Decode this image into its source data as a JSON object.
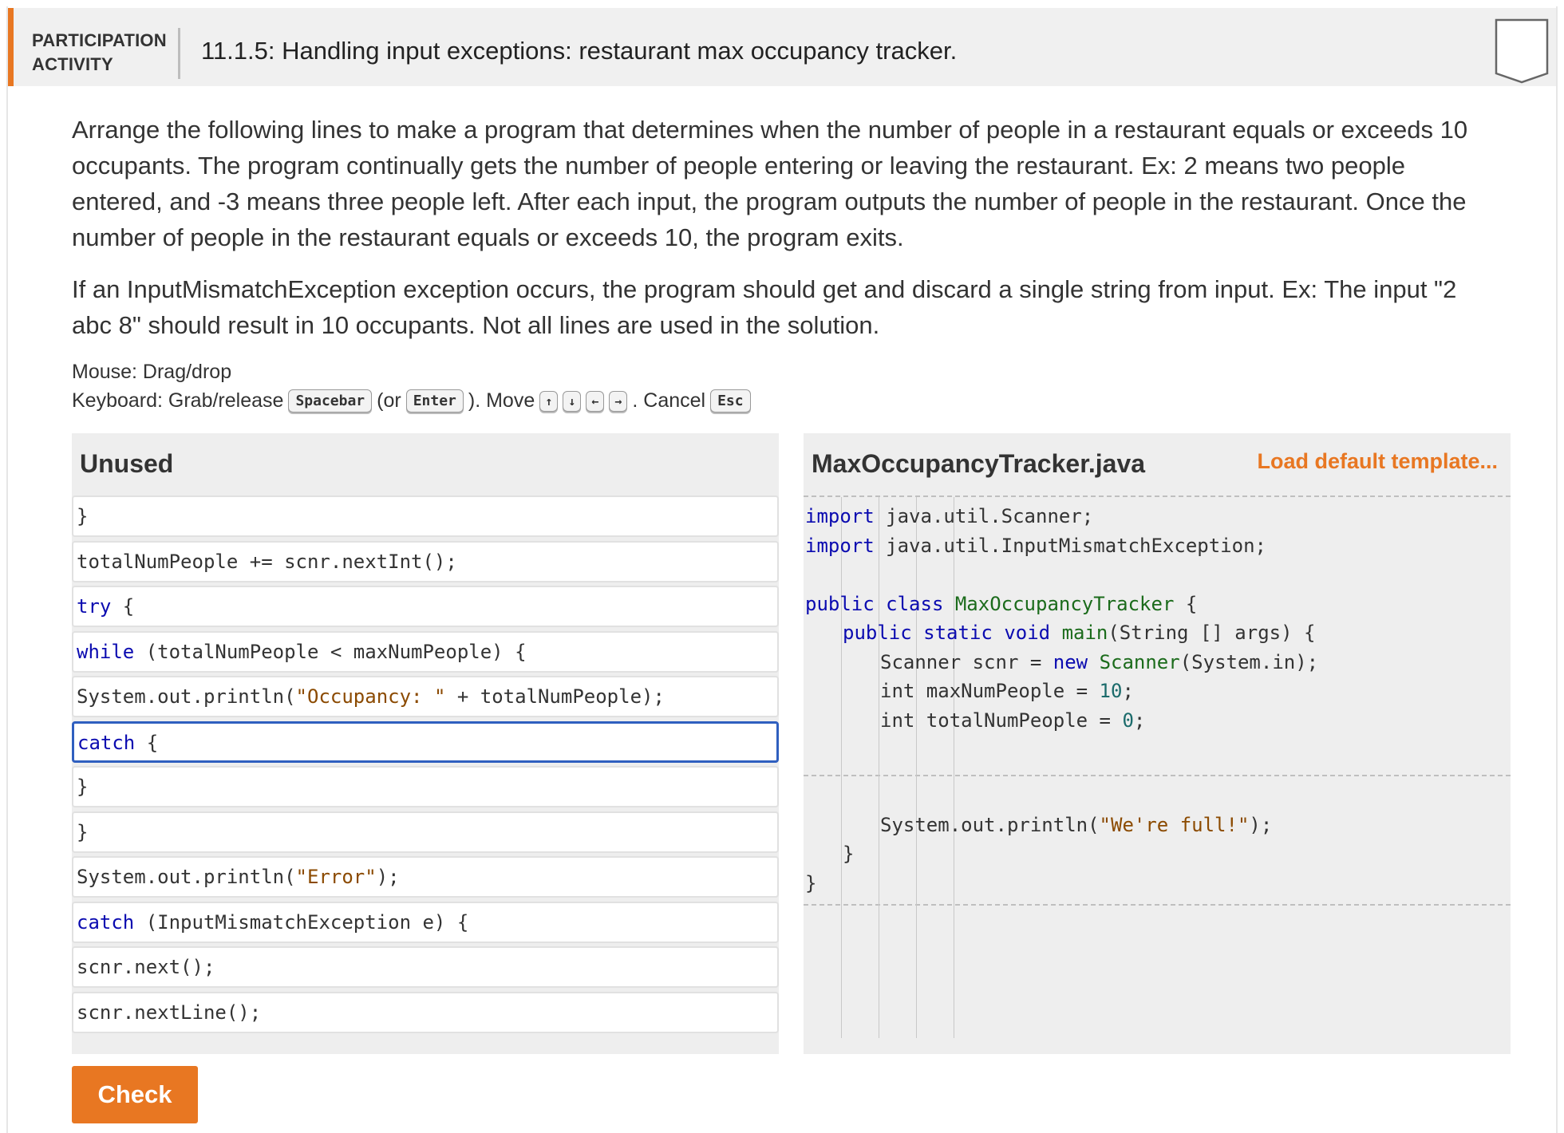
{
  "header": {
    "label_line1": "PARTICIPATION",
    "label_line2": "ACTIVITY",
    "title": "11.1.5: Handling input exceptions: restaurant max occupancy tracker."
  },
  "instructions": {
    "p1": "Arrange the following lines to make a program that determines when the number of people in a restaurant equals or exceeds 10 occupants. The program continually gets the number of people entering or leaving the restaurant. Ex: 2 means two people entered, and -3 means three people left. After each input, the program outputs the number of people in the restaurant. Once the number of people in the restaurant equals or exceeds 10, the program exits.",
    "p2": "If an InputMismatchException exception occurs, the program should get and discard a single string from input. Ex: The input \"2 abc 8\" should result in 10 occupants. Not all lines are used in the solution.",
    "mouse_hint": "Mouse: Drag/drop",
    "kb_prefix": "Keyboard: Grab/release",
    "kb_spacebar": "Spacebar",
    "kb_or": "(or",
    "kb_enter": "Enter",
    "kb_move": "). Move",
    "kb_up": "↑",
    "kb_down": "↓",
    "kb_left": "←",
    "kb_right": "→",
    "kb_cancel": ". Cancel",
    "kb_esc": "Esc"
  },
  "unused": {
    "title": "Unused",
    "blocks": [
      {
        "tokens": [
          {
            "t": "}",
            "c": ""
          }
        ]
      },
      {
        "tokens": [
          {
            "t": "totalNumPeople += scnr.nextInt();",
            "c": ""
          }
        ]
      },
      {
        "tokens": [
          {
            "t": "try",
            "c": "kw"
          },
          {
            "t": " {",
            "c": ""
          }
        ]
      },
      {
        "tokens": [
          {
            "t": "while",
            "c": "kw"
          },
          {
            "t": " (totalNumPeople < maxNumPeople) {",
            "c": ""
          }
        ]
      },
      {
        "tokens": [
          {
            "t": "System.out.println(",
            "c": ""
          },
          {
            "t": "\"Occupancy: \"",
            "c": "str"
          },
          {
            "t": " + totalNumPeople);",
            "c": ""
          }
        ]
      },
      {
        "tokens": [
          {
            "t": "catch",
            "c": "kw"
          },
          {
            "t": " {",
            "c": ""
          }
        ],
        "selected": true
      },
      {
        "tokens": [
          {
            "t": "}",
            "c": ""
          }
        ]
      },
      {
        "tokens": [
          {
            "t": "}",
            "c": ""
          }
        ]
      },
      {
        "tokens": [
          {
            "t": "System.out.println(",
            "c": ""
          },
          {
            "t": "\"Error\"",
            "c": "str"
          },
          {
            "t": ");",
            "c": ""
          }
        ]
      },
      {
        "tokens": [
          {
            "t": "catch",
            "c": "kw"
          },
          {
            "t": " (InputMismatchException e) {",
            "c": ""
          }
        ]
      },
      {
        "tokens": [
          {
            "t": "scnr.next();",
            "c": ""
          }
        ]
      },
      {
        "tokens": [
          {
            "t": "scnr.nextLine();",
            "c": ""
          }
        ]
      }
    ]
  },
  "target": {
    "title": "MaxOccupancyTracker.java",
    "load_label": "Load default template...",
    "lines": [
      {
        "indent": 0,
        "row": 0,
        "tokens": [
          {
            "t": "import",
            "c": "kw"
          },
          {
            "t": " java.util.Scanner;",
            "c": ""
          }
        ]
      },
      {
        "indent": 0,
        "row": 1,
        "tokens": [
          {
            "t": "import",
            "c": "kw"
          },
          {
            "t": " java.util.InputMismatchException;",
            "c": ""
          }
        ]
      },
      {
        "indent": 0,
        "row": 3,
        "tokens": [
          {
            "t": "public",
            "c": "kw"
          },
          {
            "t": " ",
            "c": ""
          },
          {
            "t": "class",
            "c": "kw"
          },
          {
            "t": " ",
            "c": ""
          },
          {
            "t": "MaxOccupancyTracker",
            "c": "cls"
          },
          {
            "t": " {",
            "c": ""
          }
        ]
      },
      {
        "indent": 1,
        "row": 4,
        "tokens": [
          {
            "t": "public",
            "c": "kw"
          },
          {
            "t": " ",
            "c": ""
          },
          {
            "t": "static",
            "c": "kw"
          },
          {
            "t": " ",
            "c": ""
          },
          {
            "t": "void",
            "c": "kw"
          },
          {
            "t": " ",
            "c": ""
          },
          {
            "t": "main",
            "c": "cls"
          },
          {
            "t": "(String [] args) {",
            "c": ""
          }
        ]
      },
      {
        "indent": 2,
        "row": 5,
        "tokens": [
          {
            "t": "Scanner scnr = ",
            "c": ""
          },
          {
            "t": "new",
            "c": "kw"
          },
          {
            "t": " ",
            "c": ""
          },
          {
            "t": "Scanner",
            "c": "cls"
          },
          {
            "t": "(System.in);",
            "c": ""
          }
        ]
      },
      {
        "indent": 2,
        "row": 6,
        "tokens": [
          {
            "t": "int maxNumPeople = ",
            "c": ""
          },
          {
            "t": "10",
            "c": "num"
          },
          {
            "t": ";",
            "c": ""
          }
        ]
      },
      {
        "indent": 2,
        "row": 7,
        "tokens": [
          {
            "t": "int totalNumPeople = ",
            "c": ""
          },
          {
            "t": "0",
            "c": "num"
          },
          {
            "t": ";",
            "c": ""
          }
        ]
      },
      {
        "indent": 2,
        "row": 10.6,
        "tokens": [
          {
            "t": "System.out.println(",
            "c": ""
          },
          {
            "t": "\"We're full!\"",
            "c": "str"
          },
          {
            "t": ");",
            "c": ""
          }
        ]
      },
      {
        "indent": 1,
        "row": 11.6,
        "tokens": [
          {
            "t": "}",
            "c": ""
          }
        ]
      },
      {
        "indent": 0,
        "row": 12.6,
        "tokens": [
          {
            "t": "}",
            "c": ""
          }
        ]
      }
    ]
  },
  "check_label": "Check"
}
